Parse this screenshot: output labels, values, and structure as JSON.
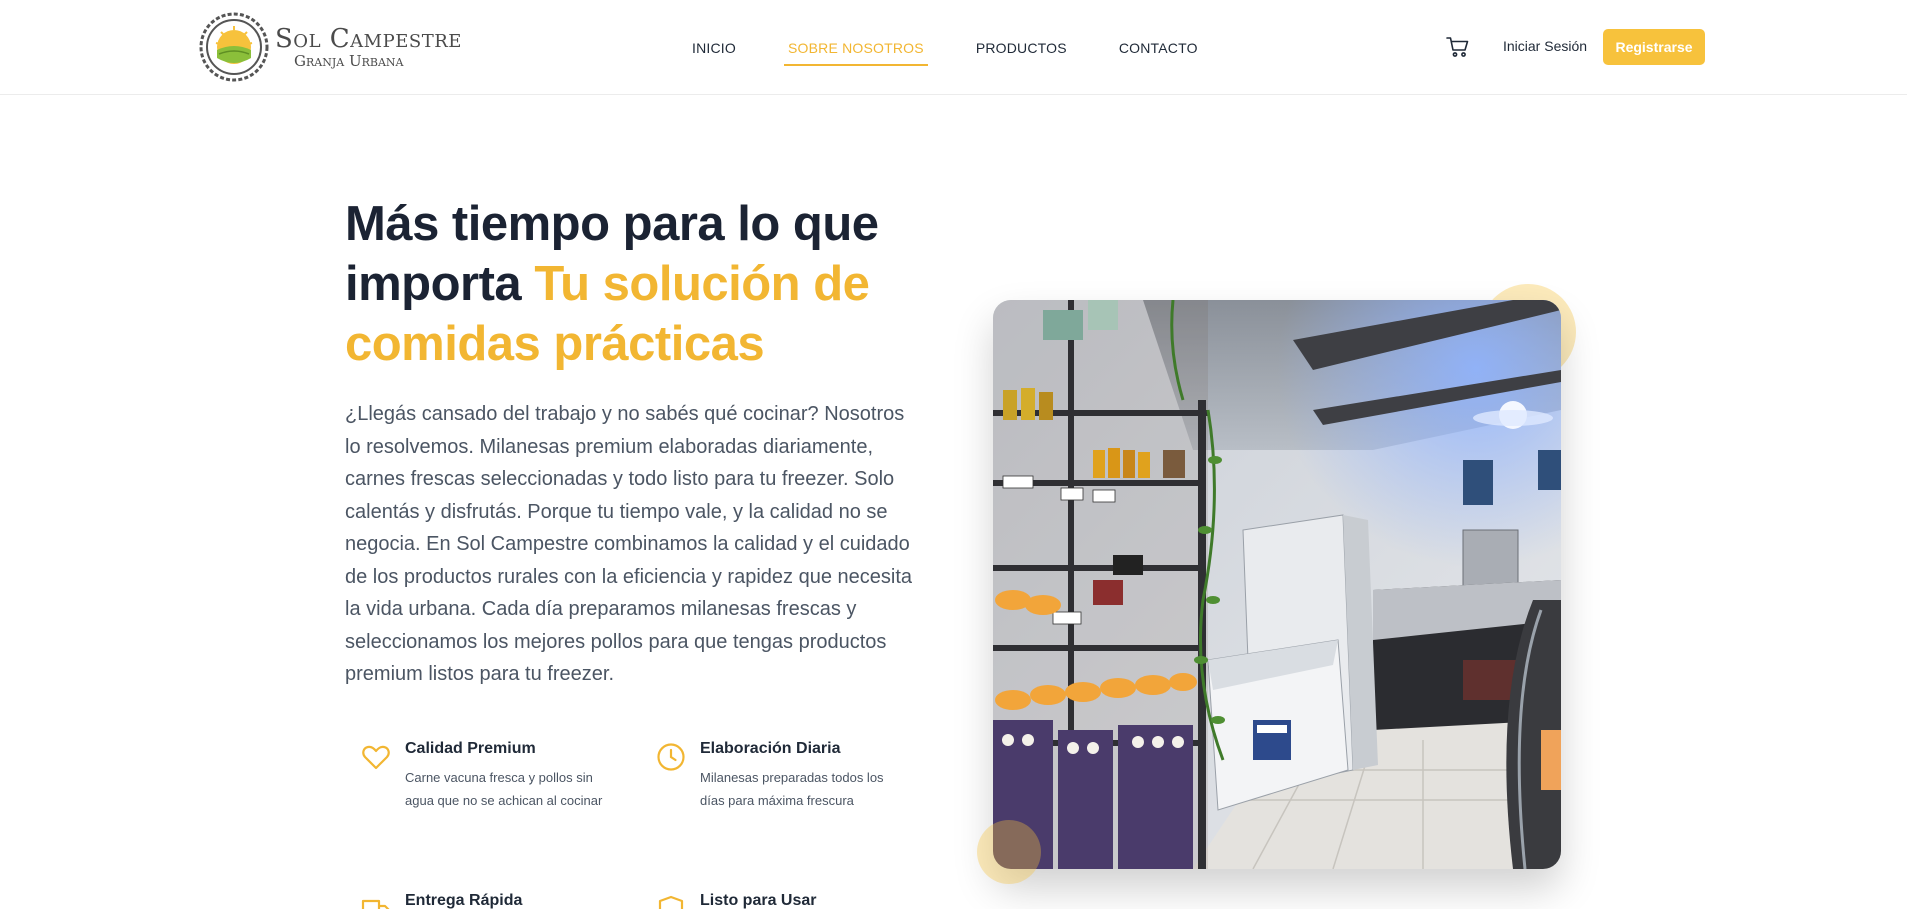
{
  "brand": {
    "name": "Sol Campestre",
    "tagline": "Granja Urbana",
    "badge_top": "SOL CAMPESTRE",
    "badge_bottom": "GRANJA URBANA"
  },
  "nav": {
    "items": [
      {
        "label": "INICIO",
        "active": false
      },
      {
        "label": "SOBRE NOSOTROS",
        "active": true
      },
      {
        "label": "PRODUCTOS",
        "active": false
      },
      {
        "label": "CONTACTO",
        "active": false
      }
    ]
  },
  "header_actions": {
    "cart_icon": "shopping-cart-icon",
    "login_label": "Iniciar Sesión",
    "register_label": "Registrarse"
  },
  "hero": {
    "title_line": "Más tiempo para lo que importa",
    "title_accent": "Tu solución de comidas prácticas",
    "description": "¿Llegás cansado del trabajo y no sabés qué cocinar? Nosotros lo resolvemos. Milanesas premium elaboradas diariamente, carnes frescas seleccionadas y todo listo para tu freezer. Solo calentás y disfrutás. Porque tu tiempo vale, y la calidad no se negocia. En Sol Campestre combinamos la calidad y el cuidado de los productos rurales con la eficiencia y rapidez que necesita la vida urbana. Cada día preparamos milanesas frescas y seleccionamos los mejores pollos para que tengas productos premium listos para tu freezer."
  },
  "features": [
    {
      "icon": "heart-icon",
      "title": "Calidad Premium",
      "desc": "Carne vacuna fresca y pollos sin agua que no se achican al cocinar"
    },
    {
      "icon": "clock-icon",
      "title": "Elaboración Diaria",
      "desc": "Milanesas preparadas todos los días para máxima frescura"
    },
    {
      "icon": "truck-icon",
      "title": "Entrega Rápida",
      "desc": ""
    },
    {
      "icon": "shield-icon",
      "title": "Listo para Usar",
      "desc": ""
    }
  ],
  "colors": {
    "accent": "#f2b632",
    "button": "#f7c23c",
    "heading": "#1b2333",
    "body_text": "#4b5563"
  }
}
